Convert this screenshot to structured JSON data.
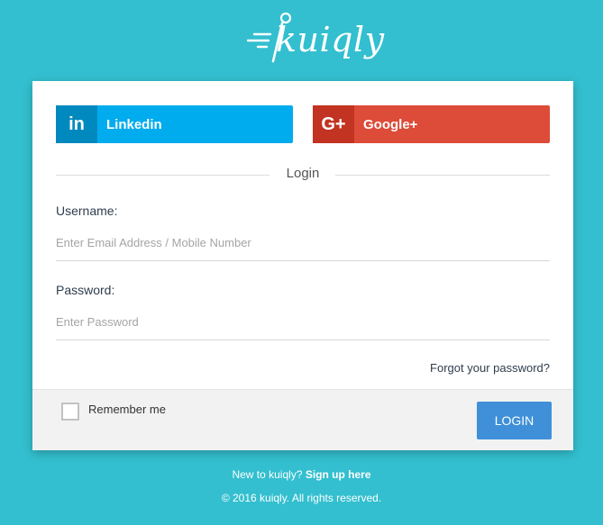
{
  "brand": {
    "name": "kuiqly"
  },
  "social": {
    "linkedin": {
      "icon_text": "in",
      "label": "Linkedin",
      "icon": "linkedin-icon"
    },
    "google": {
      "icon_text": "G+",
      "label": "Google+",
      "icon": "google-plus-icon"
    }
  },
  "divider": {
    "label": "Login"
  },
  "form": {
    "username": {
      "label": "Username:",
      "placeholder": "Enter Email Address / Mobile Number"
    },
    "password": {
      "label": "Password:",
      "placeholder": "Enter Password"
    },
    "forgot": "Forgot your password?",
    "remember": "Remember me",
    "login": "LOGIN"
  },
  "footer": {
    "new_text": "New to kuiqly?",
    "signup_link": "Sign up here",
    "copyright": "© 2016 kuiqly. All rights reserved."
  },
  "colors": {
    "background": "#33bfcf",
    "linkedin": "#00acee",
    "google": "#dd4b39",
    "login_button": "#3f90d8"
  }
}
